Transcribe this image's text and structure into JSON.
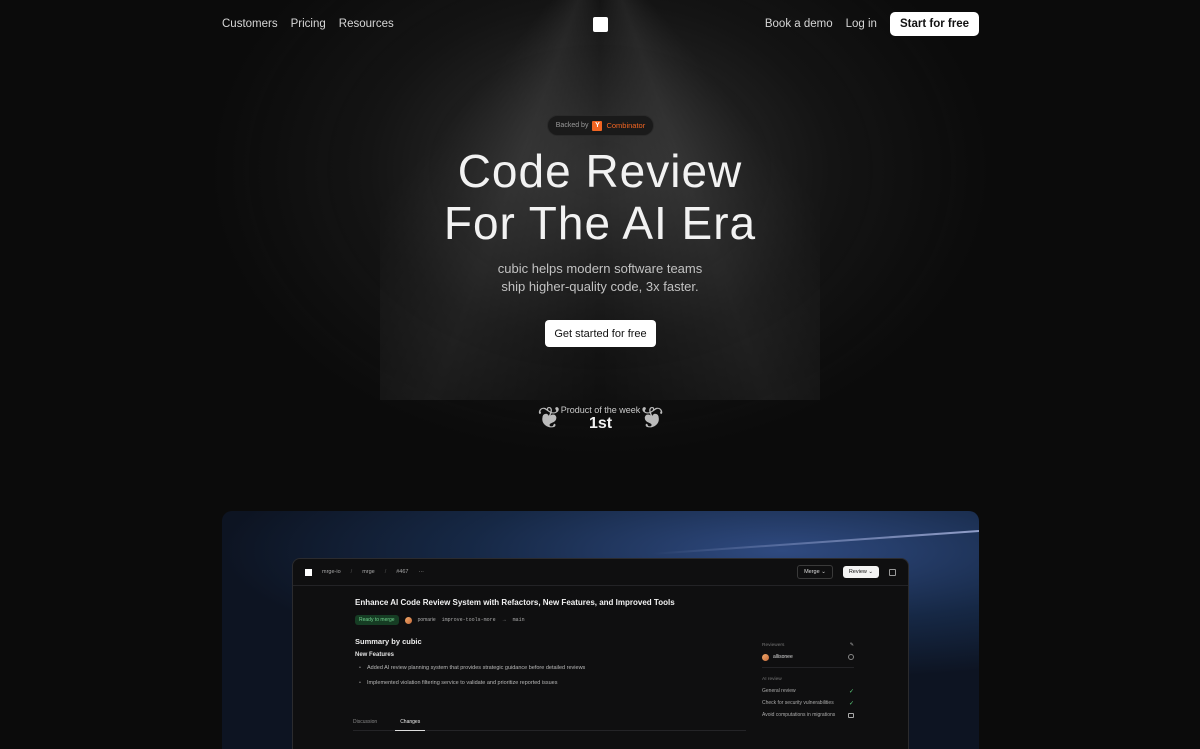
{
  "nav": {
    "left": [
      "Customers",
      "Pricing",
      "Resources"
    ],
    "book_demo": "Book a demo",
    "login": "Log in",
    "start": "Start for free"
  },
  "hero": {
    "backed_by": "Backed by",
    "yc_mark": "Y",
    "yc_name": "Combinator",
    "title_line1": "Code Review",
    "title_line2": "For The AI Era",
    "sub_line1": "cubic helps modern software teams",
    "sub_line2": "ship higher-quality code, 3x faster.",
    "cta": "Get started for free",
    "award_label": "Product of the week",
    "award_rank": "1st"
  },
  "app": {
    "breadcrumb": [
      "mrge-io",
      "mrge",
      "#467"
    ],
    "more": "···",
    "merge": "Merge",
    "review": "Review",
    "pr_title": "Enhance AI Code Review System with Refactors, New Features, and Improved Tools",
    "status": "Ready to merge",
    "author": "pomarie",
    "branch_from": "improve-tools-more",
    "branch_to": "main",
    "summary_heading": "Summary by cubic",
    "new_features_heading": "New Features",
    "bullets": [
      "Added AI review planning system that provides strategic guidance before detailed reviews",
      "Implemented violation filtering service to validate and prioritize reported issues"
    ],
    "tabs": [
      "Discussion",
      "Changes"
    ],
    "sidebar": {
      "reviewers_heading": "Reviewers",
      "reviewer": "allisonee",
      "ai_review_heading": "AI review",
      "checks": [
        "General review",
        "Check for security vulnerabilities",
        "Avoid computations in migrations"
      ]
    }
  }
}
